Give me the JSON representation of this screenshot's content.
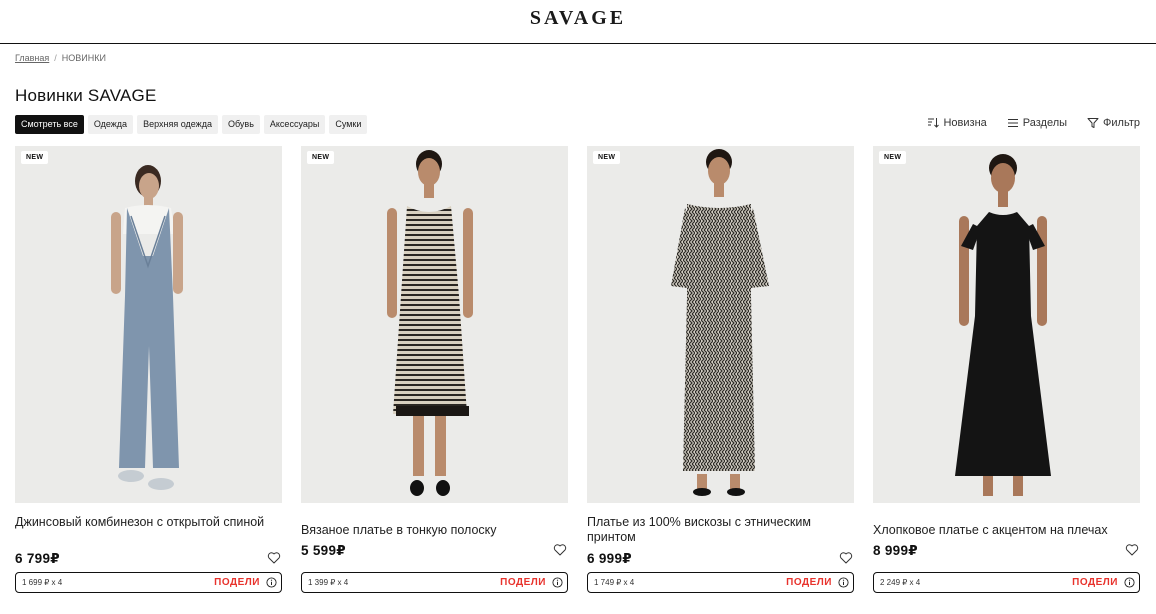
{
  "header": {
    "logo": "SAVAGE"
  },
  "breadcrumb": {
    "home": "Главная",
    "separator": "/",
    "current": "НОВИНКИ"
  },
  "page": {
    "title": "Новинки SAVAGE"
  },
  "filters": [
    "Смотреть все",
    "Одежда",
    "Верхняя одежда",
    "Обувь",
    "Аксессуары",
    "Сумки"
  ],
  "tools": {
    "sort": "Новизна",
    "sections": "Разделы",
    "filter": "Фильтр"
  },
  "products": [
    {
      "badge": "NEW",
      "name": "Джинсовый комбинезон с открытой спиной",
      "price": "6 799₽",
      "installment": "1 699 ₽ x 4",
      "podeli": "ПОДЕЛИ",
      "garment_color": "#7f95ad"
    },
    {
      "badge": "NEW",
      "name": "Вязаное платье в тонкую полоску",
      "price": "5 599₽",
      "installment": "1 399 ₽ x 4",
      "podeli": "ПОДЕЛИ",
      "garment_color": "#d8d0c0"
    },
    {
      "badge": "NEW",
      "name": "Платье из 100% вискозы с этническим принтом",
      "price": "6 999₽",
      "installment": "1 749 ₽ x 4",
      "podeli": "ПОДЕЛИ",
      "garment_color": "#7a756b"
    },
    {
      "badge": "NEW",
      "name": "Хлопковое платье с акцентом на плечах",
      "price": "8 999₽",
      "installment": "2 249 ₽ x 4",
      "podeli": "ПОДЕЛИ",
      "garment_color": "#141414"
    }
  ],
  "colors": {
    "accent": "#111111",
    "podeli_red": "#e8322c",
    "photo_bg": "#ebebe9"
  },
  "icons": {
    "sort": "sort-icon",
    "sections": "list-icon",
    "filter": "funnel-icon",
    "favorite": "heart-icon",
    "info": "info-icon"
  }
}
